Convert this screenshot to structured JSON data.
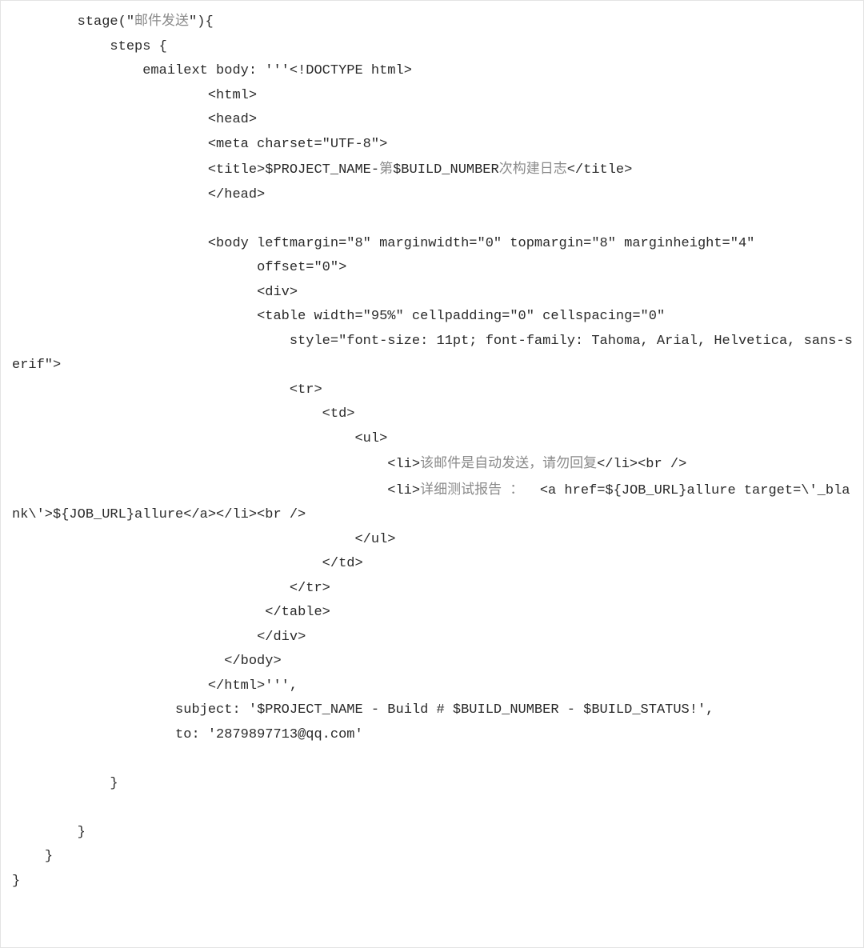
{
  "code": {
    "lines": [
      {
        "indent": "        ",
        "segments": [
          {
            "text": "stage(\""
          },
          {
            "text": "邮件发送",
            "cjk": true
          },
          {
            "text": "\"){"
          }
        ]
      },
      {
        "indent": "            ",
        "segments": [
          {
            "text": "steps {"
          }
        ]
      },
      {
        "indent": "                ",
        "segments": [
          {
            "text": "emailext body: '''<!DOCTYPE html>"
          }
        ]
      },
      {
        "indent": "                        ",
        "segments": [
          {
            "text": "<html>"
          }
        ]
      },
      {
        "indent": "                        ",
        "segments": [
          {
            "text": "<head>"
          }
        ]
      },
      {
        "indent": "                        ",
        "segments": [
          {
            "text": "<meta charset=\"UTF-8\">"
          }
        ]
      },
      {
        "indent": "                        ",
        "segments": [
          {
            "text": "<title>$PROJECT_NAME-"
          },
          {
            "text": "第",
            "cjk": true
          },
          {
            "text": "$BUILD_NUMBER"
          },
          {
            "text": "次构建日志",
            "cjk": true
          },
          {
            "text": "</title>"
          }
        ]
      },
      {
        "indent": "                        ",
        "segments": [
          {
            "text": "</head>"
          }
        ]
      },
      {
        "indent": "",
        "segments": [
          {
            "text": ""
          }
        ]
      },
      {
        "indent": "                        ",
        "segments": [
          {
            "text": "<body leftmargin=\"8\" marginwidth=\"0\" topmargin=\"8\" marginheight=\"4\""
          }
        ]
      },
      {
        "indent": "                              ",
        "segments": [
          {
            "text": "offset=\"0\">"
          }
        ]
      },
      {
        "indent": "                              ",
        "segments": [
          {
            "text": "<div>"
          }
        ]
      },
      {
        "indent": "                              ",
        "segments": [
          {
            "text": "<table width=\"95%\" cellpadding=\"0\" cellspacing=\"0\""
          }
        ]
      },
      {
        "indent": "                                  ",
        "segments": [
          {
            "text": "style=\"font-size: 11pt; font-family: Tahoma, Arial, Helvetica, sans-serif\">"
          }
        ]
      },
      {
        "indent": "                                  ",
        "segments": [
          {
            "text": "<tr>"
          }
        ]
      },
      {
        "indent": "                                      ",
        "segments": [
          {
            "text": "<td>"
          }
        ]
      },
      {
        "indent": "                                          ",
        "segments": [
          {
            "text": "<ul>"
          }
        ]
      },
      {
        "indent": "                                              ",
        "segments": [
          {
            "text": "<li>"
          },
          {
            "text": "该邮件是自动发送，请勿回复",
            "cjk": true
          },
          {
            "text": "</li><br />"
          }
        ]
      },
      {
        "indent": "                                              ",
        "segments": [
          {
            "text": "<li>"
          },
          {
            "text": "详细测试报告 ：  ",
            "cjk": true
          },
          {
            "text": "<a href=${JOB_URL}allure target=\\'_blank\\'>${JOB_URL}allure</a></li><br />"
          }
        ]
      },
      {
        "indent": "                                          ",
        "segments": [
          {
            "text": "</ul>"
          }
        ]
      },
      {
        "indent": "                                      ",
        "segments": [
          {
            "text": "</td>"
          }
        ]
      },
      {
        "indent": "                                  ",
        "segments": [
          {
            "text": "</tr>"
          }
        ]
      },
      {
        "indent": "                               ",
        "segments": [
          {
            "text": "</table>"
          }
        ]
      },
      {
        "indent": "                              ",
        "segments": [
          {
            "text": "</div>"
          }
        ]
      },
      {
        "indent": "                          ",
        "segments": [
          {
            "text": "</body>"
          }
        ]
      },
      {
        "indent": "                        ",
        "segments": [
          {
            "text": "</html>''',"
          }
        ]
      },
      {
        "indent": "                    ",
        "segments": [
          {
            "text": "subject: '$PROJECT_NAME - Build # $BUILD_NUMBER - $BUILD_STATUS!',"
          }
        ]
      },
      {
        "indent": "                    ",
        "segments": [
          {
            "text": "to: '2879897713@qq.com'"
          }
        ]
      },
      {
        "indent": "",
        "segments": [
          {
            "text": ""
          }
        ]
      },
      {
        "indent": "            ",
        "segments": [
          {
            "text": "}"
          }
        ]
      },
      {
        "indent": "",
        "segments": [
          {
            "text": ""
          }
        ]
      },
      {
        "indent": "        ",
        "segments": [
          {
            "text": "}"
          }
        ]
      },
      {
        "indent": "    ",
        "segments": [
          {
            "text": "}"
          }
        ]
      },
      {
        "indent": "",
        "segments": [
          {
            "text": "}"
          }
        ]
      }
    ]
  }
}
